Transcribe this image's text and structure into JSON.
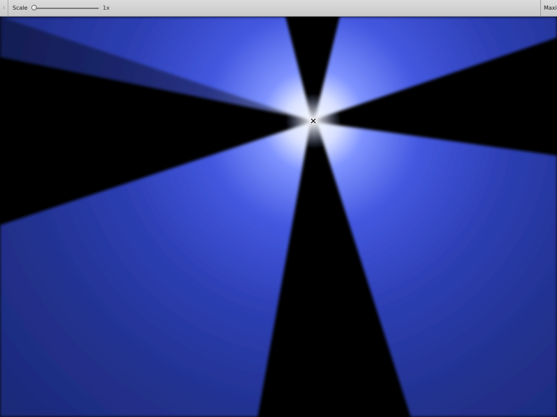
{
  "toolbar": {
    "scale_label": "Scale",
    "scale_value": "1x",
    "maximize_label": "Maxim",
    "grip_icon": "grip-icon"
  },
  "scene": {
    "background_color": "#000000",
    "beam_color": "#3c52d8",
    "core_color": "#ffffff",
    "cursor_icon": "crosshair-icon"
  }
}
